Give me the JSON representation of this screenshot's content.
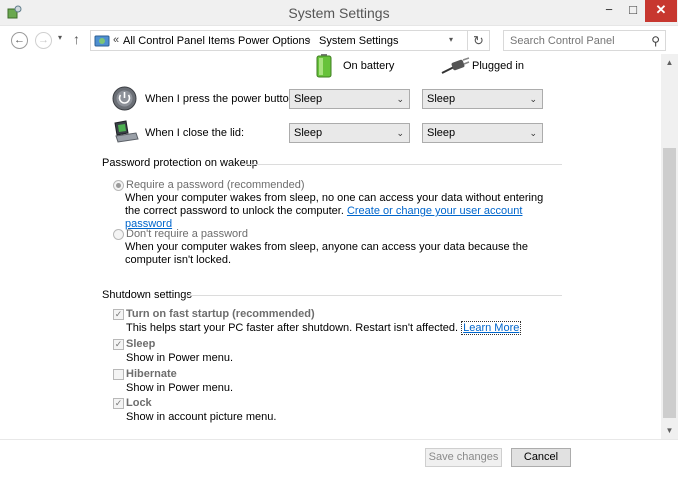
{
  "window": {
    "title": "System Settings",
    "minimize": "−",
    "maximize": "□",
    "close": "✕",
    "app_icon": "battery-settings-icon"
  },
  "nav": {
    "back_icon": "←",
    "forward_icon": "→",
    "recent_icon": "▾",
    "up_icon": "↑",
    "breadcrumb_lead": "«",
    "breadcrumbs": [
      "All Control Panel Items",
      "Power Options",
      "System Settings"
    ],
    "separator": "›",
    "address_drop": "▾",
    "refresh_icon": "↻",
    "search_placeholder": "Search Control Panel",
    "search_icon": "⚲"
  },
  "power": {
    "on_battery": "On battery",
    "plugged_in": "Plugged in",
    "rows": [
      {
        "label": "When I press the power button:",
        "battery": "Sleep",
        "plugged": "Sleep",
        "icon": "power-button-icon"
      },
      {
        "label": "When I close the lid:",
        "battery": "Sleep",
        "plugged": "Sleep",
        "icon": "laptop-lid-icon"
      }
    ],
    "dropdown_arrow": "⌄"
  },
  "password": {
    "heading": "Password protection on wakeup",
    "require_label": "Require a password (recommended)",
    "require_desc": "When your computer wakes from sleep, no one can access your data without entering the correct password to unlock the computer.",
    "require_link": "Create or change your user account password",
    "norequire_label": "Don't require a password",
    "norequire_desc": "When your computer wakes from sleep, anyone can access your data because the computer isn't locked.",
    "selected": "require"
  },
  "shutdown": {
    "heading": "Shutdown settings",
    "items": [
      {
        "label": "Turn on fast startup (recommended)",
        "desc": "This helps start your PC faster after shutdown. Restart isn't affected. ",
        "link": "Learn More",
        "checked": true
      },
      {
        "label": "Sleep",
        "desc": "Show in Power menu.",
        "checked": true
      },
      {
        "label": "Hibernate",
        "desc": "Show in Power menu.",
        "checked": false
      },
      {
        "label": "Lock",
        "desc": "Show in account picture menu.",
        "checked": true
      }
    ],
    "check_mark": "✓"
  },
  "scroll": {
    "up": "▲",
    "down": "▼"
  },
  "footer": {
    "save": "Save changes",
    "cancel": "Cancel"
  }
}
